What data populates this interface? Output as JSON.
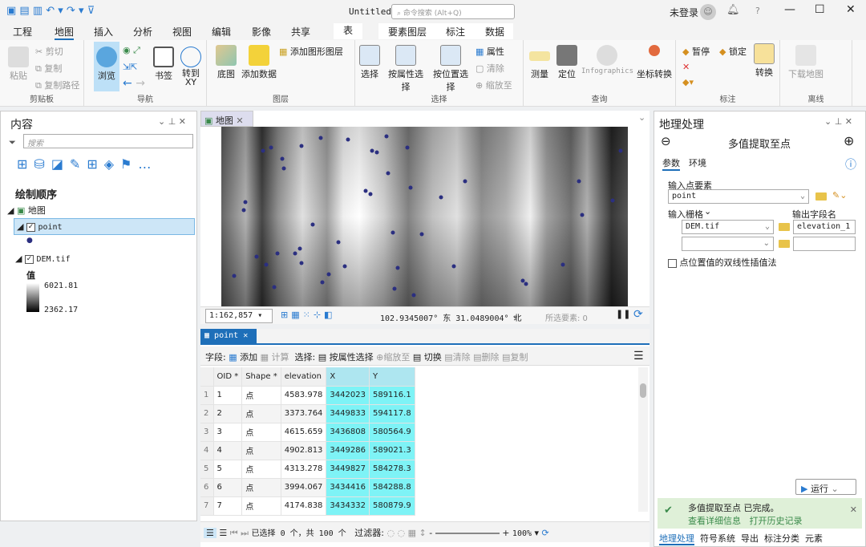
{
  "titlebar": {
    "title": "Untitled",
    "search_placeholder": "命令搜索 (Alt+Q)",
    "user": "未登录"
  },
  "tabs": [
    "工程",
    "地图",
    "插入",
    "分析",
    "视图",
    "编辑",
    "影像",
    "共享",
    "表",
    "要素图层",
    "标注",
    "数据"
  ],
  "active_tab": "地图",
  "ribbon": {
    "clipboard": {
      "label": "剪贴板",
      "paste": "粘贴",
      "cut": "剪切",
      "copy": "复制",
      "copy_path": "复制路径"
    },
    "navigate": {
      "label": "导航",
      "explore": "浏览",
      "bookmarks": "书签",
      "goto_xy": "转到\nXY"
    },
    "layer": {
      "label": "图层",
      "basemap": "底图",
      "add_data": "添加数据",
      "add_graphics": "添加图形图层"
    },
    "selection": {
      "label": "选择",
      "select": "选择",
      "by_attr": "按属性选择",
      "by_loc": "按位置选择",
      "attributes": "属性",
      "clear": "清除",
      "zoom_to": "缩放至"
    },
    "inquiry": {
      "label": "查询",
      "measure": "测量",
      "locate": "定位",
      "infographics": "Infographics",
      "coord": "坐标转换"
    },
    "labeling": {
      "label": "标注",
      "pause": "暂停",
      "lock": "锁定",
      "convert": "转换"
    },
    "offline": {
      "label": "离线",
      "download": "下载地图"
    }
  },
  "contents": {
    "title": "内容",
    "search_placeholder": "搜索",
    "drawing_order": "绘制顺序",
    "map": "地图",
    "layer_point": "point",
    "layer_dem": "DEM.tif",
    "value_label": "值",
    "max": "6021.81",
    "min": "2362.17"
  },
  "map_view": {
    "tab": "地图",
    "scale": "1:162,857",
    "coords": "102.9345007° 东 31.0489004° 北",
    "selected": "所选要素: 0"
  },
  "table_view": {
    "tab": "point",
    "fields_label": "字段:",
    "add": "添加",
    "calculate": "计算",
    "selection_label": "选择:",
    "select_by_attr": "按属性选择",
    "zoom_to": "缩放至",
    "switch": "切换",
    "clear": "清除",
    "delete": "删除",
    "copy": "复制",
    "columns": [
      "OID *",
      "Shape *",
      "elevation",
      "X",
      "Y"
    ],
    "rows": [
      [
        "1",
        "点",
        "4583.978",
        "3442023",
        "589116.1"
      ],
      [
        "2",
        "点",
        "3373.764",
        "3449833",
        "594117.8"
      ],
      [
        "3",
        "点",
        "4615.659",
        "3436808",
        "580564.9"
      ],
      [
        "4",
        "点",
        "4902.813",
        "3449286",
        "589021.3"
      ],
      [
        "5",
        "点",
        "4313.278",
        "3449827",
        "584278.3"
      ],
      [
        "6",
        "点",
        "3994.067",
        "3434416",
        "584288.8"
      ],
      [
        "7",
        "点",
        "4174.838",
        "3434332",
        "580879.9"
      ]
    ],
    "status": "已选择 0 个，共 100 个",
    "filter": "过滤器:",
    "zoom": "100%"
  },
  "geoprocessing": {
    "title": "地理处理",
    "tool": "多值提取至点",
    "tab_params": "参数",
    "tab_env": "环境",
    "input_points_label": "输入点要素",
    "input_points": "point",
    "input_rasters_label": "输入栅格",
    "output_field_label": "输出字段名",
    "raster1": "DEM.tif",
    "field1": "elevation_1",
    "bilinear": "点位置值的双线性插值法",
    "run": "运行",
    "done": "多值提取至点 已完成。",
    "details": "查看详细信息",
    "history": "打开历史记录"
  },
  "bottom_tabs": [
    "地理处理",
    "符号系统",
    "导出",
    "标注分类",
    "元素"
  ],
  "colors": {
    "accent": "#1e6fb9",
    "point": "#2b2f80",
    "xy_highlight": "#7ef3f6",
    "success_bg": "#dff0d8"
  }
}
